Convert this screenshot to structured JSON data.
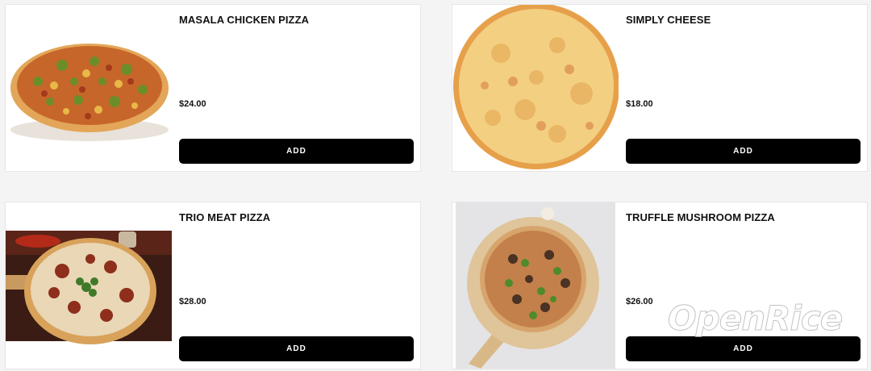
{
  "products": [
    {
      "name": "MASALA CHICKEN PIZZA",
      "price": "$24.00",
      "add_label": "ADD"
    },
    {
      "name": "SIMPLY CHEESE",
      "price": "$18.00",
      "add_label": "ADD"
    },
    {
      "name": "TRIO MEAT PIZZA",
      "price": "$28.00",
      "add_label": "ADD"
    },
    {
      "name": "TRUFFLE MUSHROOM PIZZA",
      "price": "$26.00",
      "add_label": "ADD"
    }
  ],
  "watermark": {
    "text": "OpenRice"
  },
  "colors": {
    "button_bg": "#000000",
    "button_text": "#ffffff",
    "card_bg": "#ffffff",
    "page_bg": "#f4f4f4"
  }
}
